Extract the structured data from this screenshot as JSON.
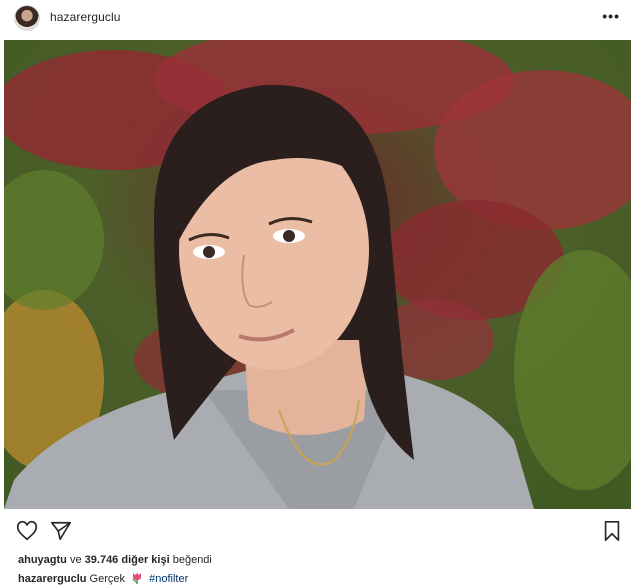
{
  "header": {
    "username": "hazarerguclu",
    "more_label": "•••"
  },
  "photo": {
    "description_icon": "selfie-photo"
  },
  "actions": {
    "like_icon": "heart-icon",
    "share_icon": "paper-plane-icon",
    "save_icon": "bookmark-icon"
  },
  "likes": {
    "user": "ahuyagtu",
    "connector": "ve",
    "count_text": "39.746 diğer kişi",
    "suffix": "beğendi"
  },
  "caption": {
    "user": "hazarerguclu",
    "text": "Gerçek",
    "emoji_icon": "tulip-icon",
    "hashtag": "#nofilter"
  },
  "colors": {
    "text": "#262626",
    "hashtag": "#00376b"
  }
}
